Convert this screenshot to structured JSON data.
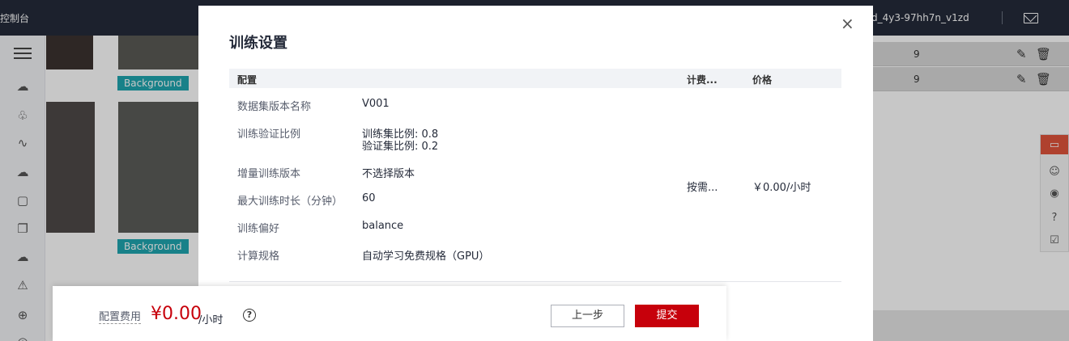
{
  "topbar": {
    "console_label": "控制台",
    "project_id": "d_4y3-97hh7n_v1zd",
    "separator": "|"
  },
  "gallery": {
    "tag1": "Background",
    "tag2": "Background"
  },
  "right_list": {
    "rows": [
      {
        "value": "9"
      },
      {
        "value": "9"
      }
    ]
  },
  "modal": {
    "title": "训练设置",
    "close": "×",
    "table": {
      "headers": [
        "配置",
        "计费...",
        "价格"
      ],
      "rows": [
        {
          "label": "数据集版本名称",
          "value": "V001"
        },
        {
          "label": "训练验证比例",
          "value": "训练集比例: 0.8",
          "value2": "验证集比例: 0.2"
        },
        {
          "label": "增量训练版本",
          "value": "不选择版本"
        },
        {
          "label": "最大训练时长（分钟）",
          "value": "60"
        },
        {
          "label": "训练偏好",
          "value": "balance"
        },
        {
          "label": "计算规格",
          "value": "自动学习免费规格（GPU）"
        }
      ],
      "billing_mode": "按需...",
      "price": "￥0.00/小时"
    }
  },
  "footer": {
    "fee_label": "配置费用",
    "fee_amount": "¥0.00",
    "fee_unit": "/小时",
    "help_glyph": "?",
    "prev_button": "上一步",
    "submit_button": "提交"
  },
  "colors": {
    "topbar_bg": "#252b3a",
    "tag_bg": "#1fa6b0",
    "primary_red": "#c7000b",
    "table_header_bg": "#f1f3f6",
    "float_active": "#e0543b"
  }
}
